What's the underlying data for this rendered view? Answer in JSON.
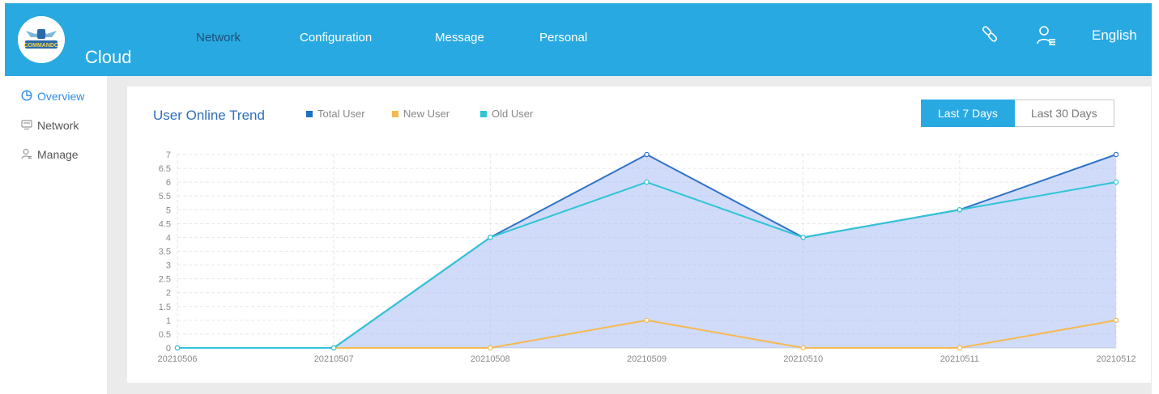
{
  "header": {
    "brand": "Cloud",
    "logo_text": "COMMANDO",
    "nav": [
      {
        "label": "Network",
        "active": true
      },
      {
        "label": "Configuration",
        "active": false
      },
      {
        "label": "Message",
        "active": false
      },
      {
        "label": "Personal",
        "active": false
      }
    ],
    "icons": [
      "link-icon",
      "user-list-icon"
    ],
    "language": "English",
    "colors": {
      "bar": "#29a9e1",
      "active_nav": "#1f4e78"
    }
  },
  "sidebar": {
    "items": [
      {
        "label": "Overview",
        "icon": "pie-chart-icon",
        "active": true
      },
      {
        "label": "Network",
        "icon": "monitor-icon",
        "active": false
      },
      {
        "label": "Manage",
        "icon": "user-icon",
        "active": false
      }
    ]
  },
  "card": {
    "title": "User Online Trend",
    "range_buttons": [
      {
        "label": "Last 7 Days",
        "active": true
      },
      {
        "label": "Last 30 Days",
        "active": false
      }
    ]
  },
  "chart_data": {
    "type": "line",
    "title": "User Online Trend",
    "categories": [
      "20210506",
      "20210507",
      "20210508",
      "20210509",
      "20210510",
      "20210511",
      "20210512"
    ],
    "series": [
      {
        "name": "Total User",
        "color": "#2f73c9",
        "values": [
          0,
          0,
          4,
          7,
          4,
          5,
          7
        ],
        "area": true
      },
      {
        "name": "New User",
        "color": "#f5b94f",
        "values": [
          0,
          0,
          0,
          1,
          0,
          0,
          1
        ]
      },
      {
        "name": "Old User",
        "color": "#2fc4d6",
        "values": [
          0,
          0,
          4,
          6,
          4,
          5,
          6
        ]
      }
    ],
    "y_ticks": [
      "0",
      "0.5",
      "1",
      "1.5",
      "2",
      "2.5",
      "3",
      "3.5",
      "4",
      "4.5",
      "5",
      "5.5",
      "6",
      "6.5",
      "7"
    ],
    "ylim": [
      0,
      7
    ],
    "grid": true,
    "legend_position": "top-left"
  }
}
